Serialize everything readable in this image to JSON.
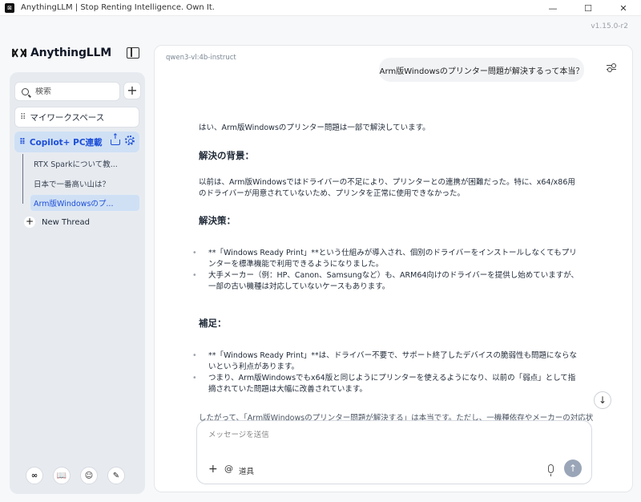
{
  "window": {
    "title": "AnythingLLM | Stop Renting Intelligence. Own It.",
    "icon_text": "⊠",
    "minimize": "—",
    "maximize": "☐",
    "close": "✕",
    "version": "v1.15.0-r2"
  },
  "brand": {
    "name": "AnythingLLM"
  },
  "sidebar": {
    "search_placeholder": "検索",
    "add_symbol": "+",
    "workspaces": [
      {
        "label": "マイワークスペース"
      },
      {
        "label": "Copilot+ PC連載"
      }
    ],
    "threads": [
      {
        "label": "RTX Sparkについて教..."
      },
      {
        "label": "日本で一番高い山は？"
      },
      {
        "label": "Arm版Windowsのプ..."
      }
    ],
    "new_thread_label": "New Thread",
    "footer": [
      "∞",
      "📖",
      "☺",
      "✎"
    ]
  },
  "chat": {
    "model": "qwen3-vl:4b-instruct",
    "user_message": "Arm版Windowsのプリンター問題が解決するって本当？",
    "answer": {
      "intro": "はい、Arm版Windowsのプリンター問題は一部で解決しています。",
      "h1": "解決の背景：",
      "p1": "以前は、Arm版Windowsではドライバーの不足により、プリンターとの連携が困難だった。特に、x64/x86用のドライバーが用意されていないため、プリンタを正常に使用できなかった。",
      "h2": "解決策：",
      "list1": [
        "**「Windows Ready Print」**という仕組みが導入され、個別のドライバーをインストールしなくてもプリンターを標準機能で利用できるようになりました。",
        "大手メーカー（例：HP、Canon、Samsungなど）も、ARM64向けのドライバーを提供し始めていますが、一部の古い機種は対応していないケースもあります。"
      ],
      "h3": "補足：",
      "list2": [
        "**「Windows Ready Print」**は、ドライバー不要で、サポート終了したデバイスの脆弱性も問題にならないという利点があります。",
        "つまり、Arm版Windowsでもx64版と同じようにプリンターを使えるようになり、以前の「弱点」として指摘されていた問題は大幅に改善されています。"
      ],
      "tail": "したがって、「Arm版Windowsのプリンター問題が解決する」は本当です。ただし、一機種依存やメーカーの対応状"
    },
    "scroll_down": "↓",
    "composer": {
      "placeholder": "メッセージを送信",
      "plus": "+",
      "at": "@",
      "tools": "道具",
      "send": "↑"
    }
  }
}
